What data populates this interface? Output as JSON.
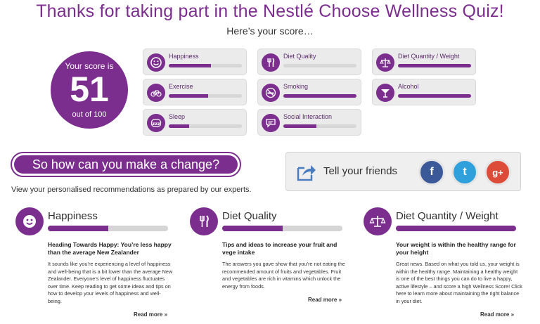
{
  "header": {
    "title": "Thanks for taking part in the Nestlé Choose Wellness Quiz!",
    "subtitle": "Here’s your score…"
  },
  "score": {
    "label": "Your score is",
    "value": "51",
    "out_of": "out of 100",
    "percent": 51
  },
  "categories": [
    {
      "name": "Happiness",
      "icon": "smiley-icon",
      "fill": 0.58
    },
    {
      "name": "Diet Quality",
      "icon": "fork-knife-icon",
      "fill": 0.0
    },
    {
      "name": "Diet Quantity / Weight",
      "icon": "scale-icon",
      "fill": 1.0
    },
    {
      "name": "Exercise",
      "icon": "bicycle-icon",
      "fill": 0.54
    },
    {
      "name": "Smoking",
      "icon": "no-smoking-icon",
      "fill": 1.0
    },
    {
      "name": "Alcohol",
      "icon": "cocktail-glass-icon",
      "fill": 1.0
    },
    {
      "name": "Sleep",
      "icon": "sleep-zzz-icon",
      "fill": 0.28
    },
    {
      "name": "Social Interaction",
      "icon": "speech-bubble-icon",
      "fill": 0.45
    }
  ],
  "change_button": {
    "label": "So how can you make a change?"
  },
  "view_text": "View your personalised recommendations as prepared by our experts.",
  "share": {
    "label": "Tell your friends",
    "networks": [
      {
        "label": "f",
        "icon": "facebook-icon",
        "color": "#3b5998"
      },
      {
        "label": "t",
        "icon": "twitter-icon",
        "color": "#2fa0dc"
      },
      {
        "label": "g+",
        "icon": "google-plus-icon",
        "color": "#dd4b39"
      }
    ]
  },
  "recommendations": [
    {
      "title": "Happiness",
      "icon": "smiley-icon",
      "fill": 0.5,
      "heading": "Heading Towards Happy: You’re less happy than the average New Zealander",
      "body": "It sounds like you’re experiencing a level of happiness and well-being that is a bit lower than the average New Zealander. Everyone’s level of happiness fluctuates over time. Keep reading to get some ideas and tips on how to develop your levels of happiness and well-being.",
      "more": "Read more »"
    },
    {
      "title": "Diet Quality",
      "icon": "fork-knife-icon",
      "fill": 0.5,
      "heading": "Tips and ideas to increase your fruit and vege intake",
      "body": "The answers you gave show that you’re not eating the recommended amount of fruits and vegetables. Fruit and vegetables are rich in vitamins which unlock the energy from foods.",
      "more": "Read more »"
    },
    {
      "title": "Diet Quantity / Weight",
      "icon": "scale-icon",
      "fill": 1.0,
      "heading": "Your weight is within the healthy range for your height",
      "body": "Great news. Based on what you told us, your weight is within the healthy range. Maintaining a healthy weight is one of the best things you can do to live a happy, active lifestyle – and score a high Wellness Score! Click here to learn more about maintaining the right balance in your diet.",
      "more": "Read more »"
    }
  ],
  "colors": {
    "accent": "#7b2e8e",
    "panel": "#ebebeb"
  }
}
